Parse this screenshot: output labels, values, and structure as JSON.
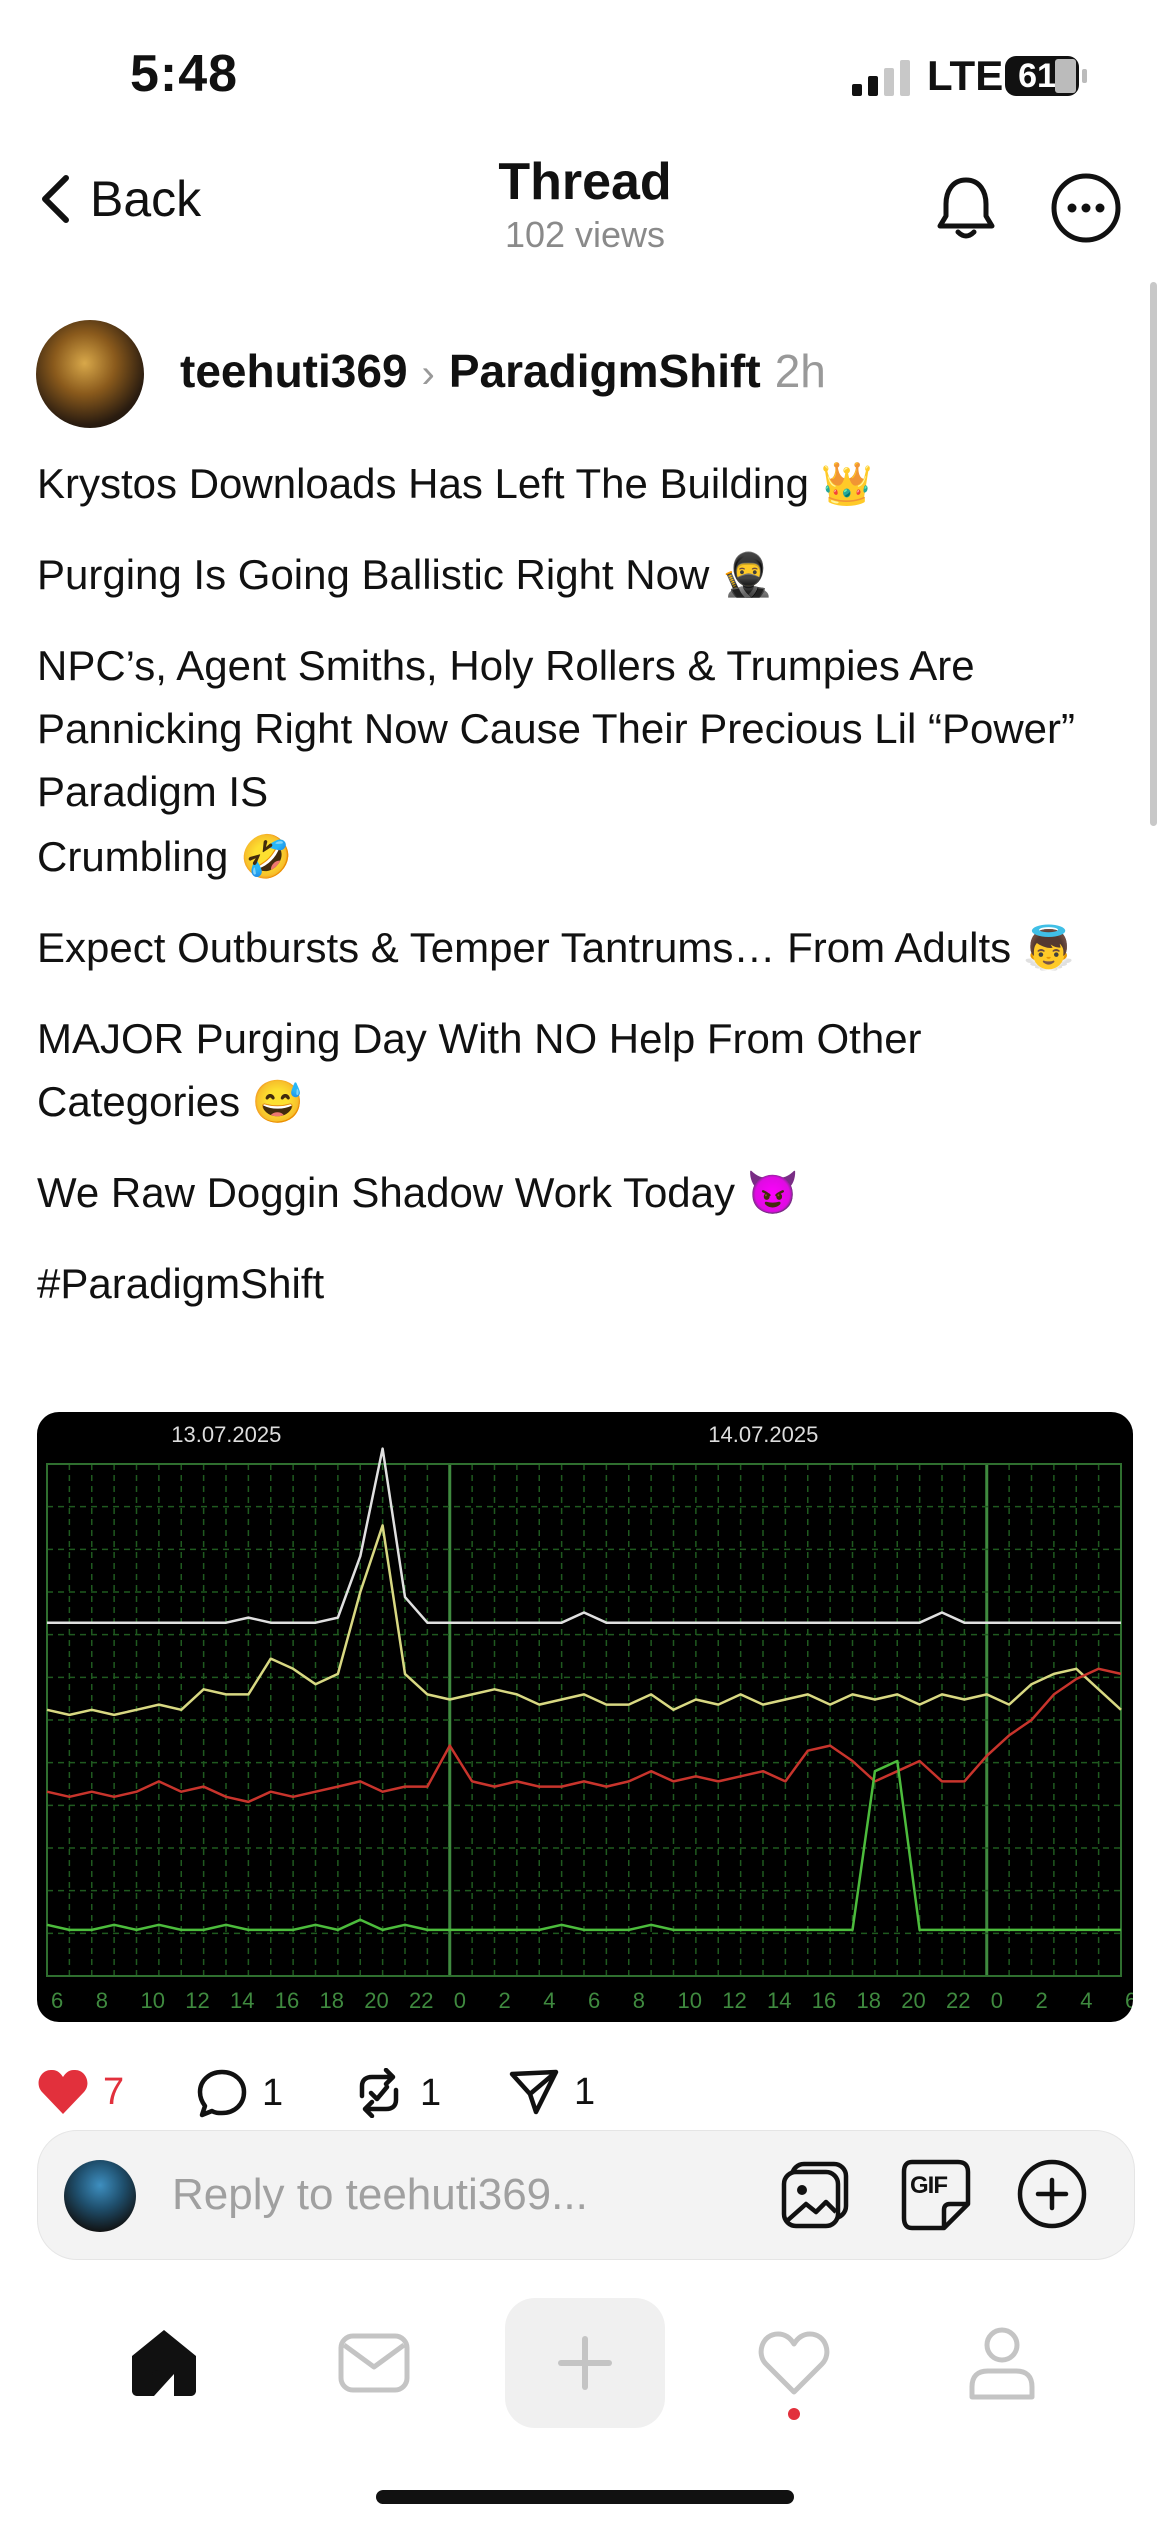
{
  "status_bar": {
    "time": "5:48",
    "network": "LTE",
    "battery": "61"
  },
  "nav": {
    "back_label": "Back",
    "title": "Thread",
    "views": "102 views"
  },
  "post": {
    "author": "teehuti369",
    "community": "ParadigmShift",
    "time_ago": "2h",
    "paragraphs": [
      "Krystos Downloads Has Left The Building 👑",
      "Purging Is Going Ballistic Right Now 🥷",
      "NPC’s, Agent Smiths, Holy Rollers & Trumpies Are Pannicking Right Now Cause Their Precious Lil “Power” Paradigm IS",
      "Crumbling 🤣",
      "Expect Outbursts & Temper Tantrums… From Adults 👼",
      "MAJOR Purging Day With NO Help From Other Categories 😅",
      "We Raw Doggin Shadow Work Today 😈",
      "#ParadigmShift"
    ]
  },
  "chart_data": {
    "type": "line",
    "date_labels": [
      "13.07.2025",
      "14.07.2025"
    ],
    "x_tick_labels": [
      "6",
      "8",
      "10",
      "12",
      "14",
      "16",
      "18",
      "20",
      "22",
      "0",
      "2",
      "4",
      "6",
      "8",
      "10",
      "12",
      "14",
      "16",
      "18",
      "20",
      "22",
      "0",
      "2",
      "4",
      "6"
    ],
    "x": [
      6,
      7,
      8,
      9,
      10,
      11,
      12,
      13,
      14,
      15,
      16,
      17,
      18,
      19,
      20,
      21,
      22,
      23,
      24,
      25,
      26,
      27,
      28,
      29,
      30,
      31,
      32,
      33,
      34,
      35,
      36,
      37,
      38,
      39,
      40,
      41,
      42,
      43,
      44,
      45,
      46,
      47,
      48,
      49,
      50,
      51,
      52,
      53,
      54
    ],
    "ylim": [
      0,
      100
    ],
    "grid": true,
    "series": [
      {
        "color": "#e0e0e0",
        "values": [
          69,
          69,
          69,
          69,
          69,
          69,
          69,
          69,
          69,
          70,
          69,
          69,
          69,
          70,
          82,
          103,
          74,
          69,
          69,
          69,
          69,
          69,
          69,
          69,
          71,
          69,
          69,
          69,
          69,
          69,
          69,
          69,
          69,
          69,
          69,
          69,
          69,
          69,
          69,
          69,
          71,
          69,
          69,
          69,
          69,
          69,
          69,
          69,
          69
        ]
      },
      {
        "color": "#d8d882",
        "values": [
          52,
          51,
          52,
          51,
          52,
          53,
          52,
          56,
          55,
          55,
          62,
          60,
          57,
          59,
          75,
          88,
          59,
          55,
          54,
          55,
          56,
          55,
          53,
          54,
          55,
          53,
          53,
          55,
          52,
          54,
          53,
          55,
          53,
          54,
          55,
          53,
          55,
          54,
          55,
          53,
          55,
          54,
          55,
          53,
          57,
          59,
          60,
          56,
          52
        ]
      },
      {
        "color": "#c8342c",
        "values": [
          36,
          35,
          36,
          35,
          36,
          38,
          36,
          37,
          35,
          34,
          36,
          35,
          36,
          37,
          38,
          36,
          37,
          37,
          45,
          38,
          37,
          38,
          37,
          37,
          38,
          37,
          38,
          40,
          38,
          39,
          38,
          39,
          40,
          38,
          44,
          45,
          42,
          38,
          40,
          42,
          38,
          38,
          43,
          47,
          50,
          55,
          58,
          60,
          59
        ]
      },
      {
        "color": "#4cbc3c",
        "values": [
          10,
          9,
          9,
          10,
          9,
          10,
          9,
          9,
          10,
          9,
          9,
          9,
          10,
          9,
          11,
          9,
          10,
          9,
          9,
          9,
          9,
          9,
          9,
          10,
          9,
          9,
          9,
          10,
          9,
          9,
          9,
          9,
          9,
          9,
          9,
          9,
          9,
          40,
          42,
          9,
          9,
          9,
          9,
          9,
          9,
          9,
          9,
          9,
          9
        ]
      }
    ]
  },
  "actions": {
    "likes": "7",
    "comments": "1",
    "reposts": "1",
    "shares": "1"
  },
  "reply": {
    "placeholder": "Reply to teehuti369...",
    "gif_label": "GIF"
  },
  "colors": {
    "like": "#e2303c",
    "text": "#111111",
    "muted": "#999999"
  },
  "icons": [
    "back-chevron-icon",
    "bell-icon",
    "more-icon",
    "heart-icon",
    "comment-icon",
    "repost-icon",
    "share-icon",
    "photo-icon",
    "gif-icon",
    "plus-circle-icon",
    "home-icon",
    "inbox-icon",
    "plus-icon",
    "heart-tab-icon",
    "profile-icon"
  ]
}
